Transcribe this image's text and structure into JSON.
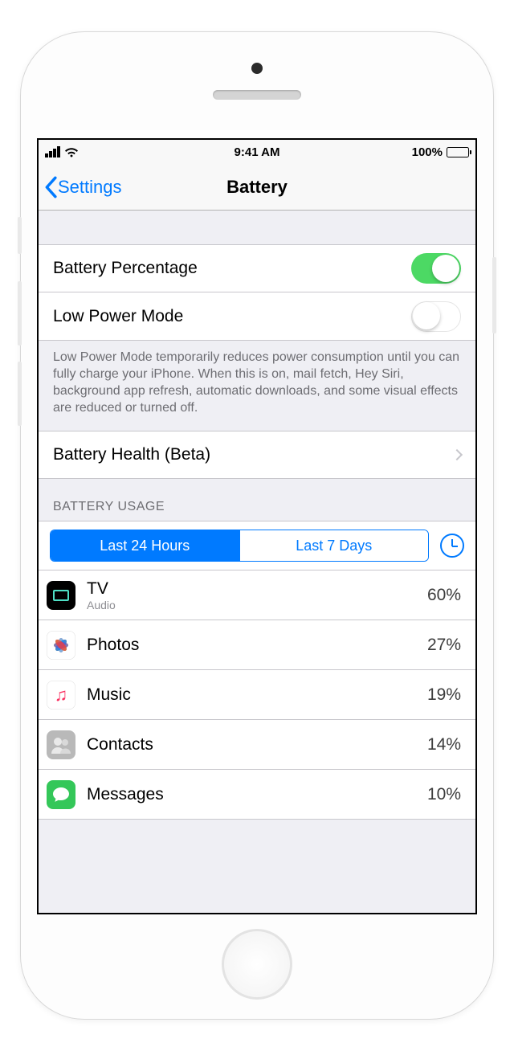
{
  "status_bar": {
    "time": "9:41 AM",
    "battery_pct": "100%"
  },
  "nav": {
    "back_label": "Settings",
    "title": "Battery"
  },
  "rows": {
    "battery_percentage": {
      "label": "Battery Percentage",
      "on": true
    },
    "low_power_mode": {
      "label": "Low Power Mode",
      "on": false
    },
    "low_power_footer": "Low Power Mode temporarily reduces power consumption until you can fully charge your iPhone. When this is on, mail fetch, Hey Siri, background app refresh, automatic downloads, and some visual effects are reduced or turned off.",
    "battery_health": {
      "label": "Battery Health (Beta)"
    }
  },
  "usage_section": {
    "header": "BATTERY USAGE",
    "segments": [
      "Last 24 Hours",
      "Last 7 Days"
    ],
    "active_segment": 0,
    "apps": [
      {
        "name": "TV",
        "sub": "Audio",
        "pct": "60%",
        "icon": "tv"
      },
      {
        "name": "Photos",
        "sub": "",
        "pct": "27%",
        "icon": "photos"
      },
      {
        "name": "Music",
        "sub": "",
        "pct": "19%",
        "icon": "music"
      },
      {
        "name": "Contacts",
        "sub": "",
        "pct": "14%",
        "icon": "contacts"
      },
      {
        "name": "Messages",
        "sub": "",
        "pct": "10%",
        "icon": "messages"
      }
    ]
  }
}
